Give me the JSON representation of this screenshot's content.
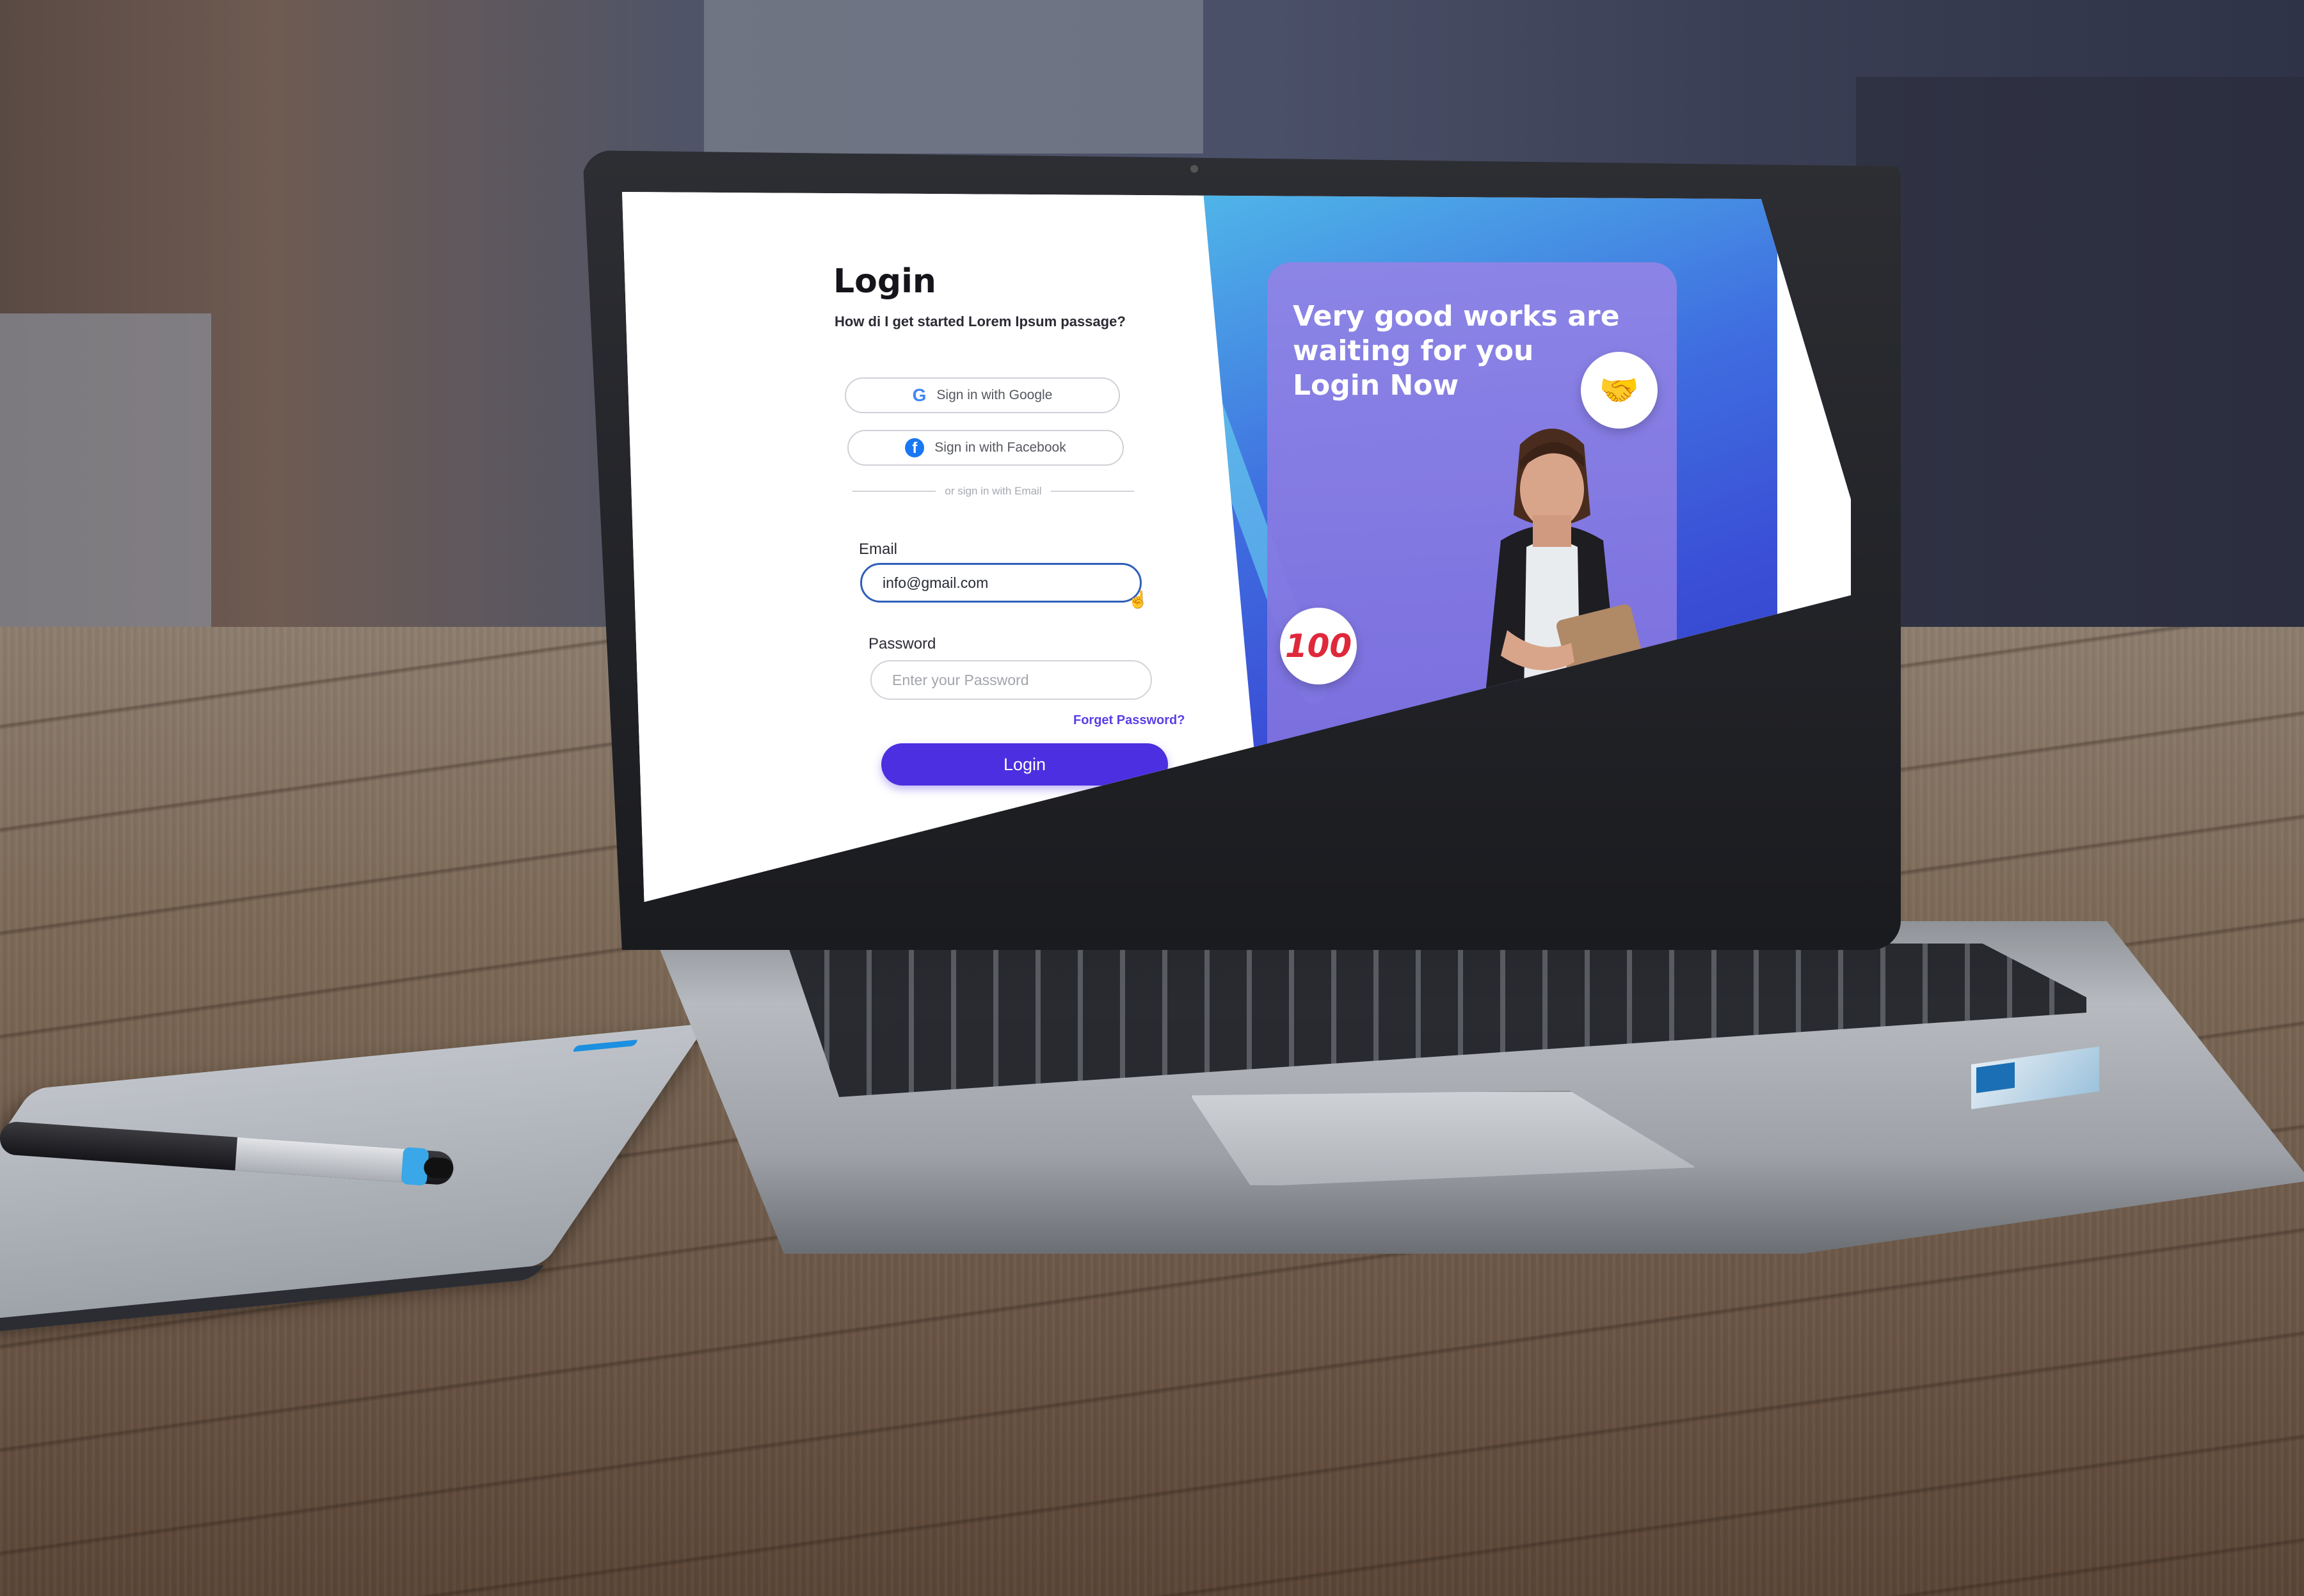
{
  "login": {
    "title": "Login",
    "subtitle": "How di I get started Lorem Ipsum passage?",
    "google_label": "Sign in with Google",
    "facebook_label": "Sign in with Facebook",
    "divider_text": "or sign in with Email",
    "email_label": "Email",
    "email_value": "info@gmail.com",
    "password_label": "Password",
    "password_placeholder": "Enter your Password",
    "forgot_label": "Forget Password?",
    "login_button_label": "Login"
  },
  "hero": {
    "title": "Very good works are\nwaiting for you\nLogin Now",
    "badge_handshake": "🤝",
    "badge_100": "100"
  },
  "icons": {
    "google": "google-icon",
    "facebook": "facebook-icon",
    "handshake": "handshake-icon",
    "hundred": "hundred-points-icon",
    "cursor": "pointer-cursor-icon"
  },
  "colors": {
    "accent": "#4b2fe0",
    "link": "#5b3ee8",
    "hero_gradient_start": "#4fb6e8",
    "hero_gradient_end": "#2e35c0",
    "email_border": "#2f5fb8"
  }
}
